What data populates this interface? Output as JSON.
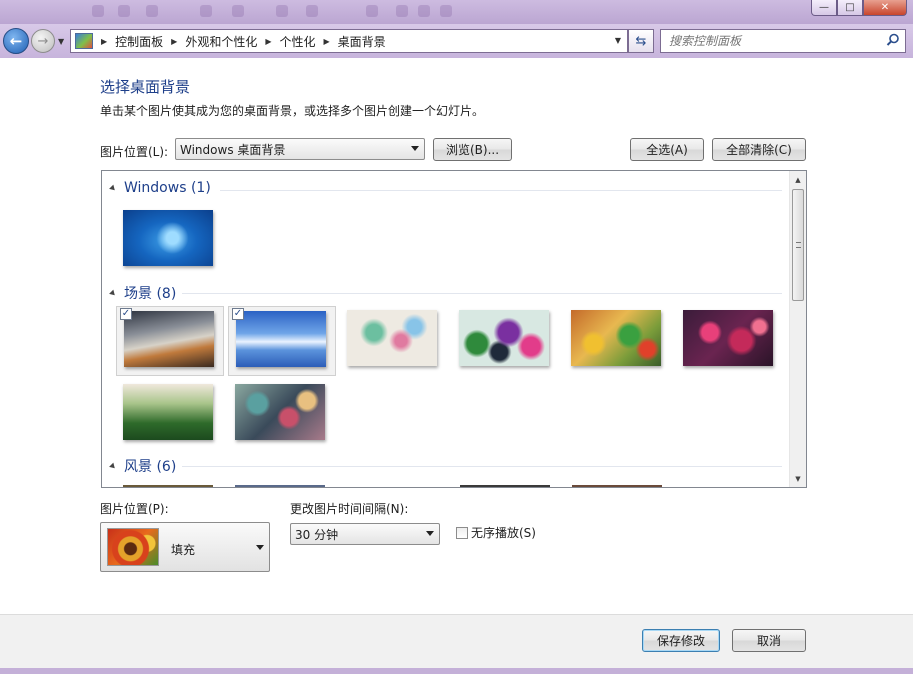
{
  "window": {
    "controls": {
      "minimize": "—",
      "maximize": "□",
      "close": "✕"
    }
  },
  "nav": {
    "breadcrumbs": [
      "控制面板",
      "外观和个性化",
      "个性化",
      "桌面背景"
    ],
    "search_placeholder": "搜索控制面板"
  },
  "page": {
    "heading": "选择桌面背景",
    "description": "单击某个图片使其成为您的桌面背景，或选择多个图片创建一个幻灯片。"
  },
  "location": {
    "label": "图片位置(L):",
    "value": "Windows 桌面背景",
    "browse_button": "浏览(B)...",
    "select_all_button": "全选(A)",
    "clear_all_button": "全部清除(C)"
  },
  "gallery": {
    "groups": [
      {
        "title": "Windows (1)"
      },
      {
        "title": "场景 (8)"
      },
      {
        "title": "风景 (6)"
      }
    ],
    "checks": [
      "✓",
      "✓"
    ],
    "scroll_up": "▲",
    "scroll_down": "▼"
  },
  "position": {
    "label": "图片位置(P):",
    "value": "填充"
  },
  "interval": {
    "label": "更改图片时间间隔(N):",
    "value": "30 分钟"
  },
  "shuffle": {
    "label": "无序播放(S)",
    "checked": false
  },
  "footer": {
    "save_button": "保存修改",
    "cancel_button": "取消"
  },
  "colors": {
    "heading": "#1e3f8a",
    "frame": "#c9b7d9",
    "accent": "#3c7fb1"
  }
}
